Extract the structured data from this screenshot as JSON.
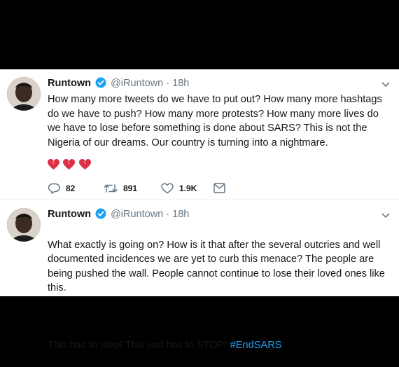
{
  "tweets": [
    {
      "author_name": "Runtown",
      "author_handle": "@iRuntown",
      "separator": " · ",
      "time": "18h",
      "text": "How many more tweets do we have to put out? How many more hashtags do we have to push? How many more protests? How many more lives do we have to lose before something is done about SARS? This is not the Nigeria of our dreams. Our country is turning into a nightmare.",
      "emoji": [
        "broken-heart",
        "broken-heart",
        "broken-heart"
      ],
      "replies": "82",
      "retweets": "891",
      "likes": "1.9K"
    },
    {
      "author_name": "Runtown",
      "author_handle": "@iRuntown",
      "separator": " · ",
      "time": "18h",
      "text_main": "What exactly is going on? How is it that after the several outcries and well documented incidences we are yet to curb this menace? The people are being pushed the wall. People cannot continue to lose their loved ones like this.",
      "text_end": "This has to stop! This just has to STOP! ",
      "hashtag": "#EndSARS"
    }
  ],
  "colors": {
    "accent": "#1da1f2",
    "text": "#14171a",
    "muted": "#657786",
    "heart": "#e0245e"
  }
}
